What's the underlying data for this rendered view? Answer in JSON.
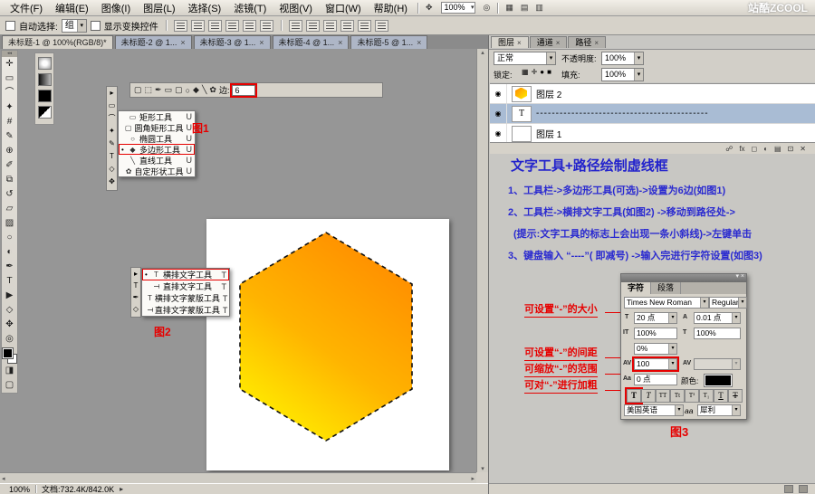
{
  "window": {
    "watermark": "站酷ZCOOL"
  },
  "menubar": {
    "items": [
      "文件(F)",
      "编辑(E)",
      "图像(I)",
      "图层(L)",
      "选择(S)",
      "滤镜(T)",
      "视图(V)",
      "窗口(W)",
      "帮助(H)"
    ],
    "zoom_value": "100%",
    "icons": [
      "✥",
      "◎",
      "▦",
      "▤",
      "▥"
    ]
  },
  "optionsbar": {
    "auto_select_label": "自动选择:",
    "auto_select_value": "组",
    "show_transform_label": "显示变换控件",
    "icon_names": [
      "align-top-edges",
      "align-vertical-centers",
      "align-bottom-edges",
      "align-left-edges",
      "align-horizontal-centers",
      "align-right-edges",
      "distribute-top-edges",
      "distribute-vertical-centers",
      "distribute-bottom-edges",
      "distribute-left-edges",
      "distribute-horizontal-centers",
      "distribute-right-edges"
    ]
  },
  "tabs": {
    "active": "未标题-1 @ 100%(RGB/8)*",
    "inactive": [
      "未标题-2 @ 1...",
      "未标题-3 @ 1...",
      "未标题-4 @ 1...",
      "未标题-5 @ 1..."
    ]
  },
  "tools": {
    "glyphs": [
      "✛",
      "▭",
      "⌒",
      "✦",
      "#",
      "✎",
      "⊕",
      "✐",
      "⧉",
      "↺",
      "▱",
      "▨",
      "○",
      "◐",
      "✒",
      "T",
      "▶",
      "◇",
      "✥",
      "◎"
    ],
    "names": [
      "move",
      "marquee",
      "lasso",
      "quick-select",
      "crop",
      "eyedropper",
      "healing",
      "brush",
      "clone-stamp",
      "history-brush",
      "eraser",
      "gradient",
      "blur",
      "dodge",
      "pen",
      "type",
      "path-select",
      "shape",
      "hand",
      "zoom"
    ]
  },
  "fig1": {
    "caption": "图1",
    "bar_icons": [
      "▢",
      "⬚",
      "✒",
      "▭",
      "▢",
      "○",
      "◆",
      "╲",
      "✿"
    ],
    "sides_label": "边:",
    "sides_value": "6",
    "strip_icons": [
      "▸",
      "▭",
      "⌒",
      "✦",
      "✎",
      "T",
      "◇",
      "✥"
    ],
    "menu_icons": [
      "▭",
      "▢",
      "○",
      "◆",
      "╲",
      "✿"
    ],
    "menu": [
      {
        "label": "矩形工具",
        "key": "U"
      },
      {
        "label": "圆角矩形工具",
        "key": "U"
      },
      {
        "label": "椭圆工具",
        "key": "U"
      },
      {
        "label": "多边形工具",
        "key": "U"
      },
      {
        "label": "直线工具",
        "key": "U"
      },
      {
        "label": "自定形状工具",
        "key": "U"
      }
    ]
  },
  "fig2": {
    "caption": "图2",
    "strip_icons": [
      "▸",
      "T",
      "✒",
      "◇"
    ],
    "menu_icons": [
      "T",
      "T",
      "T",
      "T"
    ],
    "menu": [
      {
        "label": "横排文字工具",
        "key": "T"
      },
      {
        "label": "直排文字工具",
        "key": "T"
      },
      {
        "label": "横排文字蒙版工具",
        "key": "T"
      },
      {
        "label": "直排文字蒙版工具",
        "key": "T"
      }
    ]
  },
  "layers": {
    "tabs": [
      "图层",
      "通道",
      "路径"
    ],
    "blend_mode": "正常",
    "opacity_label": "不透明度:",
    "opacity_value": "100%",
    "lock_label": "锁定:",
    "lock_icons": [
      "▦",
      "✛",
      "●",
      "■"
    ],
    "fill_label": "填充:",
    "fill_value": "100%",
    "items": [
      {
        "name": "图层 2"
      },
      {
        "name": "--------------------------------------------"
      },
      {
        "name": "图层 1"
      }
    ],
    "bottom_icons": [
      "☍",
      "fx",
      "◻",
      "◐",
      "▤",
      "⊡",
      "✕"
    ]
  },
  "tutorial": {
    "title": "文字工具+路径绘制虚线框",
    "steps": [
      "1、工具栏->多边形工具(可选)->设置为6边(如图1)",
      "2、工具栏->横排文字工具(如图2) ->移动到路径处->",
      "(提示:文字工具的标志上会出现一条小斜线)->左键单击",
      "3、键盘输入 “----”( 即减号) ->输入完进行字符设置(如图3)"
    ]
  },
  "char_panel": {
    "tabs": [
      "字符",
      "段落"
    ],
    "font_family": "Times New Roman",
    "font_style": "Regular",
    "icon_size": "T",
    "size": "20 点",
    "icon_leading": "A",
    "leading": "0.01 点",
    "icon_vscale": "IT",
    "v_scale": "100%",
    "icon_hscale": "T",
    "h_scale": "100%",
    "prop_spacing": "0%",
    "icon_tracking": "AV",
    "tracking": "100",
    "icon_kerning": "AV",
    "icon_baseline": "Aa",
    "baseline": "0 点",
    "color_label": "颜色:",
    "style_buttons": [
      "T",
      "T",
      "TT",
      "Tt",
      "T¹",
      "T₁",
      "T",
      "T"
    ],
    "language": "美国英语",
    "aa_label": "aa",
    "antialias": "犀利"
  },
  "annotations": {
    "size": "可设置“-”的大小",
    "spacing": "可设置“-”的间距",
    "range": "可缩放“-”的范围",
    "bold": "可对“-”进行加粗",
    "fig3": "图3"
  },
  "statusbar": {
    "zoom": "100%",
    "doc_info": "文档:732.4K/842.0K"
  },
  "colors": {
    "annotation_red": "#e60000",
    "tutorial_blue": "#2222cc",
    "hex_orange": "#ff8a00",
    "hex_mid": "#ffb400",
    "hex_yellow": "#fff200",
    "selected_layer": "#a9bcd4"
  },
  "icons": {
    "chevron_down": "▾",
    "close": "×",
    "eye": "◉",
    "current_tool_marker": "•",
    "text_thumb": "T"
  }
}
